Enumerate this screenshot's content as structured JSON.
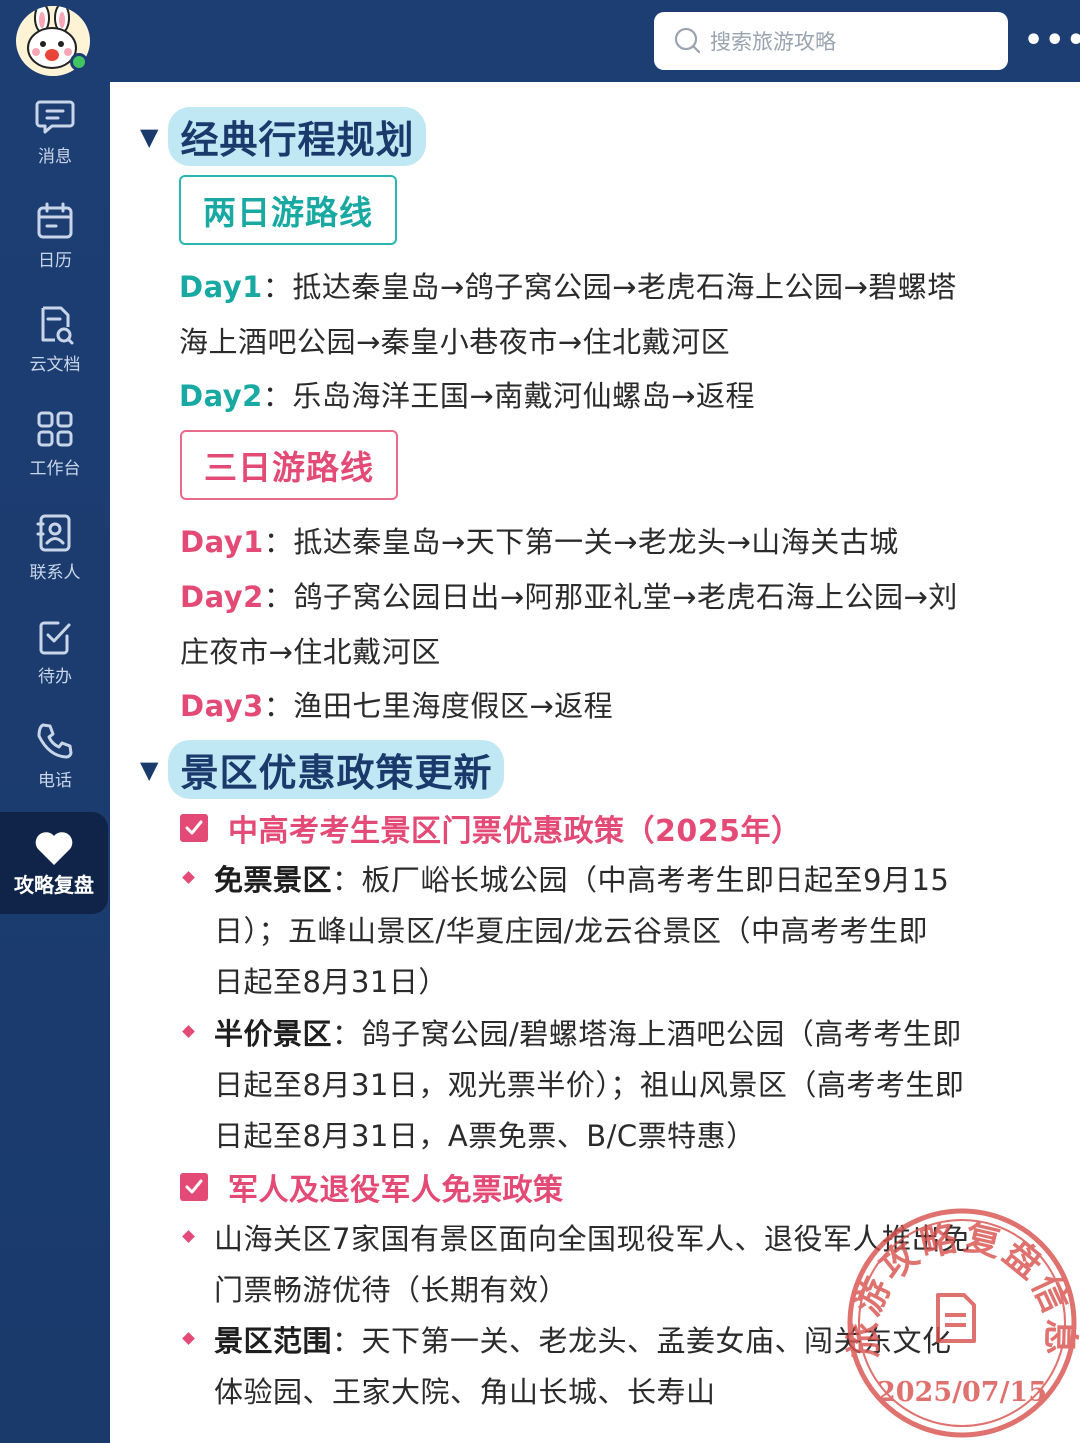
{
  "sidebar": {
    "items": [
      {
        "label": "消息",
        "icon": "message-icon"
      },
      {
        "label": "日历",
        "icon": "calendar-icon"
      },
      {
        "label": "云文档",
        "icon": "cloud-doc-icon"
      },
      {
        "label": "工作台",
        "icon": "workbench-icon"
      },
      {
        "label": "联系人",
        "icon": "contacts-icon"
      },
      {
        "label": "待办",
        "icon": "todo-icon"
      },
      {
        "label": "电话",
        "icon": "phone-icon"
      }
    ],
    "active_item": {
      "label": "攻略复盘",
      "icon": "heart-icon"
    }
  },
  "search": {
    "placeholder": "搜索旅游攻略"
  },
  "sections": {
    "itinerary": {
      "title": "经典行程规划",
      "two_day": {
        "label": "两日游路线",
        "day1_tag": "Day1",
        "day1_line1": "：抵达秦皇岛→鸽子窝公园→老虎石海上公园→碧螺塔",
        "day1_line2": "海上酒吧公园→秦皇小巷夜市→住北戴河区",
        "day2_tag": "Day2",
        "day2_line1": "：乐岛海洋王国→南戴河仙螺岛→返程"
      },
      "three_day": {
        "label": "三日游路线",
        "day1_tag": "Day1",
        "day1_line1": "：抵达秦皇岛→天下第一关→老龙头→山海关古城",
        "day2_tag": "Day2",
        "day2_line1": "：鸽子窝公园日出→阿那亚礼堂→老虎石海上公园→刘",
        "day2_line2": "庄夜市→住北戴河区",
        "day3_tag": "Day3",
        "day3_line1": "：渔田七里海度假区→返程"
      }
    },
    "policy": {
      "title": "景区优惠政策更新",
      "p1": {
        "title": "中高考考生景区门票优惠政策（2025年）",
        "b1_lead": "免票景区",
        "b1_l1": "：板厂峪长城公园（中高考考生即日起至9月15",
        "b1_l2": "日）；五峰山景区/华夏庄园/龙云谷景区（中高考考生即",
        "b1_l3": "日起至8月31日）",
        "b2_lead": "半价景区",
        "b2_l1": "：鸽子窝公园/碧螺塔海上酒吧公园（高考考生即",
        "b2_l2": "日起至8月31日，观光票半价）；祖山风景区（高考考生即",
        "b2_l3": "日起至8月31日，A票免票、B/C票特惠）"
      },
      "p2": {
        "title": "军人及退役军人免票政策",
        "b1_l1": "山海关区7家国有景区面向全国现役军人、退役军人推出免",
        "b1_l2": "门票畅游优待（长期有效）",
        "b2_lead": "景区范围",
        "b2_l1": "：天下第一关、老龙头、孟姜女庙、闯关东文化",
        "b2_l2": "体验园、王家大院、角山长城、长寿山"
      }
    }
  },
  "stamp": {
    "text": "旅游攻略复盘信息",
    "date": "2025/07/15",
    "color": "#d9534f"
  },
  "colors": {
    "sidebar": "#1d3e73",
    "teal": "#17a9a2",
    "pink": "#e34a75",
    "title_bg": "#bfe8f4"
  }
}
